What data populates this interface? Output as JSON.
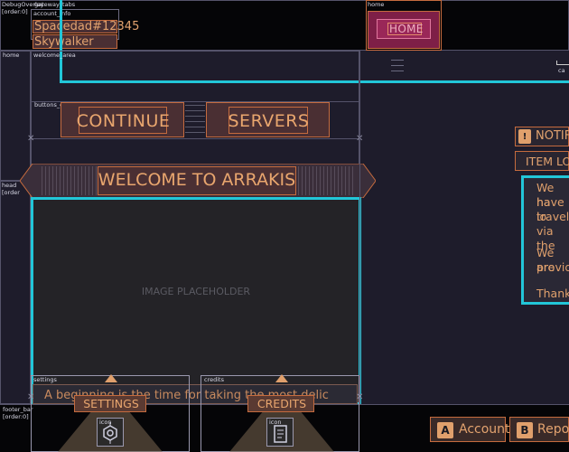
{
  "debug": {
    "top_left": "DebugOverlay",
    "order_tag": "[order:0]",
    "gateway_tabs": "gateway_tabs",
    "account_info": "account_info",
    "home_top": "home",
    "home_left": "home",
    "welcome_area": "welcome_area",
    "buttons_continue": "buttons_continue",
    "servers": "servers",
    "header": "header",
    "head_left": "head",
    "order_left": "[order",
    "ph_image": "ph_image",
    "settings": "settings",
    "credits": "credits",
    "content": "content",
    "icon_a": "icon",
    "icon_b": "icon",
    "footer_bar": "footer_bar",
    "footer_order": "[order:0]",
    "account": "account",
    "report_bug": "report_bug",
    "notifications": "notifications",
    "title": "title",
    "scroll_content": "scrollcontent",
    "cap": "ca"
  },
  "account": {
    "user_id": "Spacedad#12345",
    "user_name": "Skywalker"
  },
  "home_button": "HOME",
  "buttons": {
    "continue": "CONTINUE",
    "servers": "SERVERS"
  },
  "welcome_title": "WELCOME TO ARRAKIS",
  "image_placeholder": "IMAGE PLACEHOLDER",
  "content_text": "A beginning is the time for taking the most delicate care",
  "settings_label": "SETTINGS",
  "credits_label": "CREDITS",
  "notification": {
    "header": "NOTIFIC",
    "title": "ITEM LOS",
    "body": [
      "We ha",
      "have lo",
      "travelli",
      "via the",
      "We are",
      "provid",
      "Thank"
    ]
  },
  "footer": {
    "account_key": "A",
    "account_label": "Account",
    "report_key": "B",
    "report_label": "Report"
  }
}
